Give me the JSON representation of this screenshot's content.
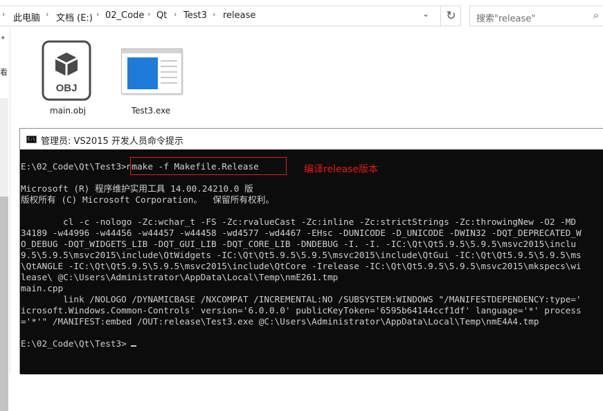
{
  "explorer": {
    "breadcrumbs": [
      "此电脑",
      "文档 (E:)",
      "02_Code",
      "Qt",
      "Test3",
      "release"
    ],
    "refresh_icon": "refresh-icon",
    "search_placeholder": "搜索\"release\"",
    "files": [
      {
        "name": "main.obj",
        "icon": "obj-file-icon",
        "badge": "OBJ"
      },
      {
        "name": "Test3.exe",
        "icon": "exe-file-icon"
      }
    ]
  },
  "console": {
    "title": "管理员: VS2015 开发人员命令提示",
    "icon_text": "C:\\",
    "annotation": "编译release版本",
    "annotation_color": "#e81818",
    "lines": [
      "E:\\02_Code\\Qt\\Test3>nmake -f Makefile.Release",
      "",
      "Microsoft (R) 程序维护实用工具 14.00.24210.0 版",
      "版权所有 (C) Microsoft Corporation。  保留所有权利。",
      "",
      "        cl -c -nologo -Zc:wchar_t -FS -Zc:rvalueCast -Zc:inline -Zc:strictStrings -Zc:throwingNew -O2 -MD",
      "34189 -w44996 -w44456 -w44457 -w44458 -wd4577 -wd4467 -EHsc -DUNICODE -D_UNICODE -DWIN32 -DQT_DEPRECATED_W",
      "O_DEBUG -DQT_WIDGETS_LIB -DQT_GUI_LIB -DQT_CORE_LIB -DNDEBUG -I. -I. -IC:\\Qt\\Qt5.9.5\\5.9.5\\msvc2015\\inclu",
      "9.5\\5.9.5\\msvc2015\\include\\QtWidgets -IC:\\Qt\\Qt5.9.5\\5.9.5\\msvc2015\\include\\QtGui -IC:\\Qt\\Qt5.9.5\\5.9.5\\ms",
      "\\QtANGLE -IC:\\Qt\\Qt5.9.5\\5.9.5\\msvc2015\\include\\QtCore -Irelease -IC:\\Qt\\Qt5.9.5\\5.9.5\\msvc2015\\mkspecs\\wi",
      "lease\\ @C:\\Users\\Administrator\\AppData\\Local\\Temp\\nmE261.tmp",
      "main.cpp",
      "        link /NOLOGO /DYNAMICBASE /NXCOMPAT /INCREMENTAL:NO /SUBSYSTEM:WINDOWS \"/MANIFESTDEPENDENCY:type='",
      "icrosoft.Windows.Common-Controls' version='6.0.0.0' publicKeyToken='6595b64144ccf1df' language='*' process",
      "='*'\" /MANIFEST:embed /OUT:release\\Test3.exe @C:\\Users\\Administrator\\AppData\\Local\\Temp\\nmE4A4.tmp",
      "",
      "E:\\02_Code\\Qt\\Test3>"
    ]
  }
}
